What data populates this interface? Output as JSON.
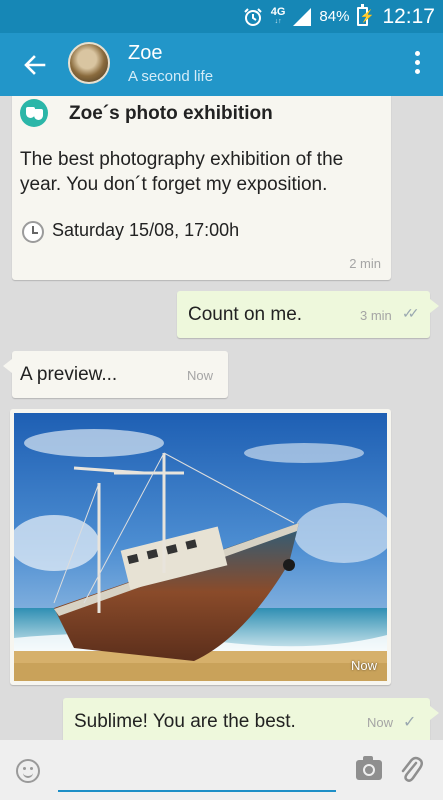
{
  "status_bar": {
    "network": "4G",
    "network_sub": "↓↑",
    "battery": "84%",
    "time": "12:17"
  },
  "header": {
    "contact_name": "Zoe",
    "contact_status": "A second life"
  },
  "messages": [
    {
      "type": "event",
      "direction": "incoming",
      "title": "Zoe´s photo exhibition",
      "description": "The best photography exhibition of the year. You don´t forget my exposition.",
      "date": "Saturday 15/08, 17:00h",
      "time": "2 min"
    },
    {
      "type": "text",
      "direction": "outgoing",
      "text": "Count on me.",
      "time": "3 min",
      "status": "read"
    },
    {
      "type": "text",
      "direction": "incoming",
      "text": "A preview...",
      "time": "Now"
    },
    {
      "type": "image",
      "direction": "incoming",
      "time": "Now"
    },
    {
      "type": "text",
      "direction": "outgoing",
      "text": "Sublime! You are the best.",
      "time": "Now",
      "status": "sent"
    }
  ],
  "composer": {
    "placeholder": ""
  },
  "colors": {
    "status_bar": "#1687b6",
    "app_bar": "#2296c9",
    "incoming_bubble": "#f7f6f0",
    "outgoing_bubble": "#eef8dc",
    "chat_background": "#dcdcdc",
    "accent": "#1d8fc7"
  },
  "icons": [
    "alarm-icon",
    "signal-icon",
    "battery-icon",
    "back-arrow-icon",
    "more-vert-icon",
    "event-mask-icon",
    "clock-icon",
    "double-check-icon",
    "check-icon",
    "emoji-icon",
    "camera-icon",
    "attach-icon"
  ]
}
